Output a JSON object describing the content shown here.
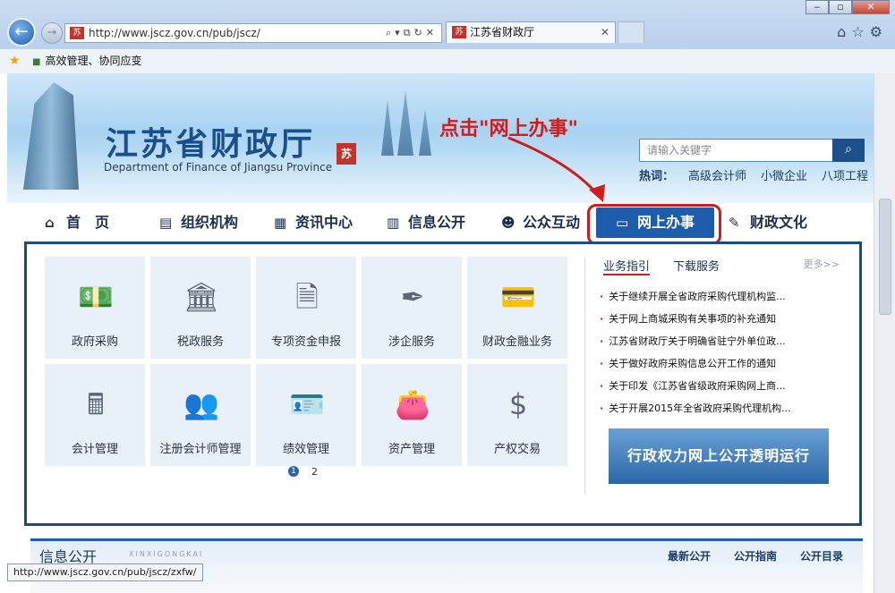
{
  "browser": {
    "url": "http://www.jscz.gov.cn/pub/jscz/",
    "tab_title": "江苏省财政厅",
    "favorites_item": "高效管理、协同应变",
    "status_url": "http://www.jscz.gov.cn/pub/jscz/zxfw/",
    "favicon_text": "苏"
  },
  "header": {
    "title": "江苏省财政厅",
    "subtitle": "Department of Finance of Jiangsu Province",
    "seal": "苏",
    "hint": "点击\"网上办事\"",
    "search_placeholder": "请输入关键字",
    "hot_label": "热词：",
    "hot_words": [
      "高级会计师",
      "小微企业",
      "八项工程"
    ]
  },
  "nav": [
    {
      "label": "首　页",
      "icon": "home-icon"
    },
    {
      "label": "组织机构",
      "icon": "id-card-icon"
    },
    {
      "label": "资讯中心",
      "icon": "grid-icon"
    },
    {
      "label": "信息公开",
      "icon": "columns-icon"
    },
    {
      "label": "公众互动",
      "icon": "people-icon"
    },
    {
      "label": "网上办事",
      "icon": "monitor-icon"
    },
    {
      "label": "财政文化",
      "icon": "scroll-icon"
    }
  ],
  "tiles": [
    {
      "label": "政府采购",
      "icon": "money-hand-icon"
    },
    {
      "label": "税政服务",
      "icon": "bank-icon"
    },
    {
      "label": "专项资金申报",
      "icon": "document-dollar-icon"
    },
    {
      "label": "涉企服务",
      "icon": "pen-nib-icon"
    },
    {
      "label": "财政金融业务",
      "icon": "card-hand-icon"
    },
    {
      "label": "会计管理",
      "icon": "calculator-icon"
    },
    {
      "label": "注册会计师管理",
      "icon": "users-icon"
    },
    {
      "label": "绩效管理",
      "icon": "id-badge-icon"
    },
    {
      "label": "资产管理",
      "icon": "wallet-icon"
    },
    {
      "label": "产权交易",
      "icon": "dollar-circle-icon"
    }
  ],
  "pager": [
    "1",
    "2"
  ],
  "news": {
    "tabs": [
      "业务指引",
      "下载服务"
    ],
    "more": "更多>>",
    "items": [
      "关于继续开展全省政府采购代理机构监...",
      "关于网上商城采购有关事项的补充通知",
      "江苏省财政厅关于明确省驻宁外单位政...",
      "关于做好政府采购信息公开工作的通知",
      "关于印发《江苏省省级政府采购网上商...",
      "关于开展2015年全省政府采购代理机构..."
    ],
    "promo": "行政权力网上公开透明运行"
  },
  "lower": {
    "title": "信息公开",
    "subtitle": "XINXIGONGKAI",
    "tabs": [
      "最新公开",
      "公开指南",
      "公开目录"
    ]
  }
}
